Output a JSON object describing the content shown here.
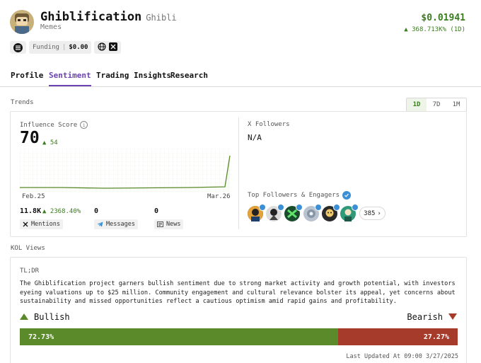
{
  "project": {
    "name": "Ghiblification",
    "ticker": "Ghibli",
    "category": "Memes",
    "price": "$0.01941",
    "price_change": "368.713K% (1D)",
    "funding_label": "Funding",
    "funding_value": "$0.00"
  },
  "tabs": [
    {
      "label": "Profile",
      "active": false
    },
    {
      "label": "Sentiment",
      "active": true
    },
    {
      "label": "Trading Insights",
      "active": false
    },
    {
      "label": "Research",
      "active": false
    }
  ],
  "trends": {
    "section_label": "Trends",
    "ranges": [
      "1D",
      "7D",
      "1M"
    ],
    "active_range": "1D",
    "influence_label": "Influence Score",
    "influence_score": "70",
    "influence_change": "54",
    "chart_start": "Feb.25",
    "chart_end": "Mar.26",
    "mentions_value": "11.8K",
    "mentions_change": "2368.40%",
    "mentions_label": "Mentions",
    "messages_value": "0",
    "messages_label": "Messages",
    "news_value": "0",
    "news_label": "News",
    "x_followers_label": "X Followers",
    "x_followers_value": "N/A",
    "top_followers_label": "Top Followers & Engagers",
    "more_count": "385"
  },
  "kol": {
    "section_label": "KOL Views",
    "tldr_label": "TL;DR",
    "summary": "The Ghiblification project garners bullish sentiment due to strong market activity and growth potential, with investors eyeing valuations up to $25 million. Community engagement and cultural relevance bolster its appeal, yet concerns about sustainability and missed opportunities reflect a cautious optimism amid rapid gains and profitability.",
    "bullish_label": "Bullish",
    "bearish_label": "Bearish",
    "bullish_pct": "72.73%",
    "bearish_pct": "27.27%",
    "last_updated": "Last Updated At 09:00 3/27/2025"
  },
  "colors": {
    "accent": "#6b43b3",
    "positive": "#3a7d1e",
    "bullish": "#5b8a2a",
    "bearish": "#a63b2c"
  }
}
